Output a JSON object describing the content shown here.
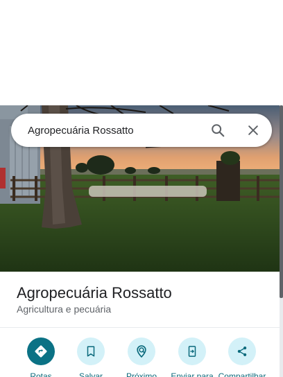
{
  "search": {
    "value": "Agropecuária Rossatto",
    "search_icon": "search-icon",
    "close_icon": "close-icon"
  },
  "place": {
    "name": "Agropecuária Rossatto",
    "category": "Agricultura e pecuária",
    "photo": "farm-photo"
  },
  "actions": [
    {
      "label": "Rotas",
      "icon": "directions-icon"
    },
    {
      "label": "Salvar",
      "icon": "bookmark-icon"
    },
    {
      "label": "Próximo",
      "icon": "nearby-icon"
    },
    {
      "label": "Enviar para",
      "icon": "send-to-phone-icon"
    },
    {
      "label": "Compartilhar",
      "icon": "share-icon"
    }
  ],
  "colors": {
    "accent": "#0b7285",
    "action_bg": "#d3f1f8",
    "action_label": "#0b6a7c",
    "title_text": "#202124",
    "secondary_text": "#5f6368"
  }
}
